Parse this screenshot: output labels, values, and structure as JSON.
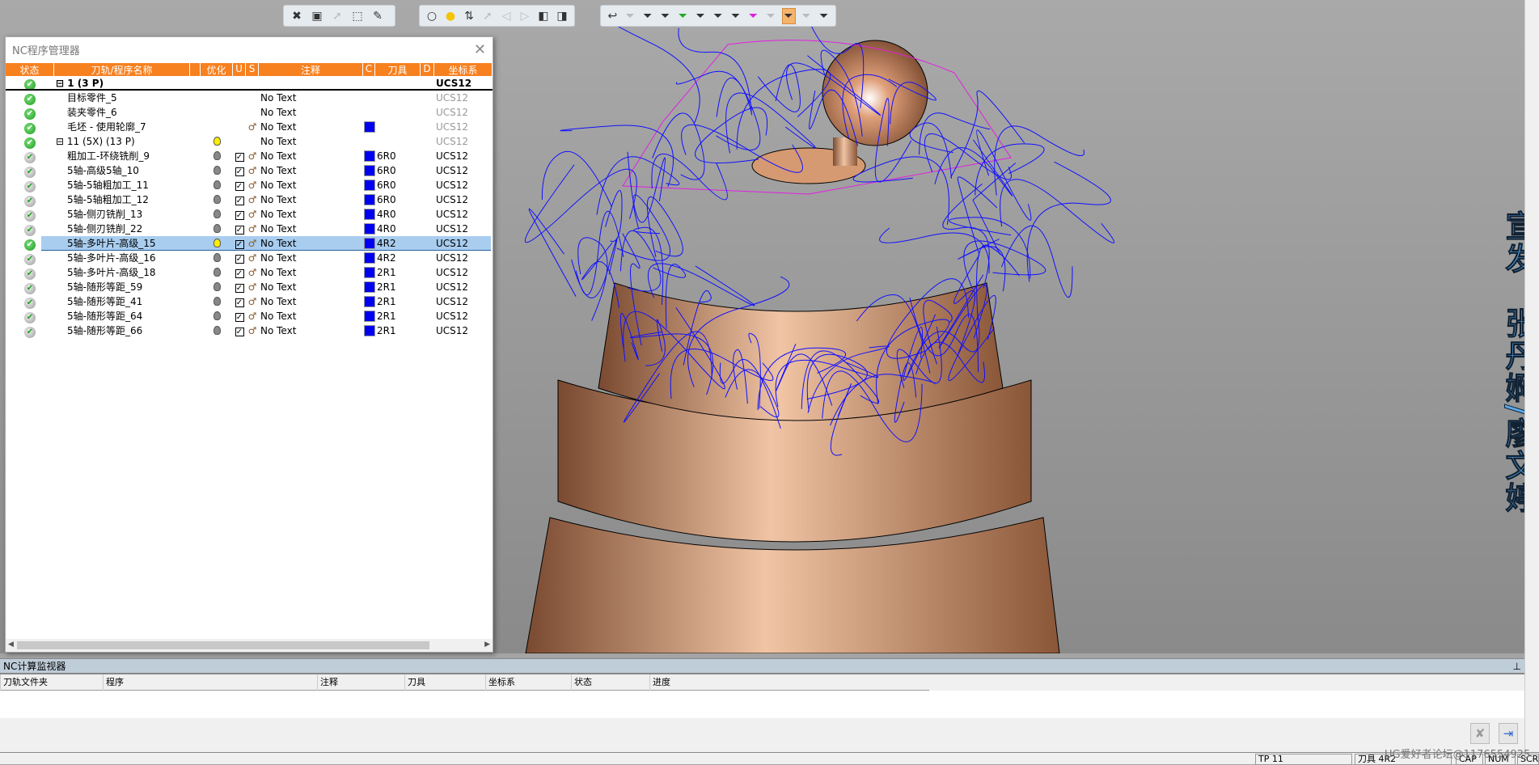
{
  "toolbars": [
    {
      "icons": [
        "deselect-icon",
        "wireframe-select-icon",
        "select-filter-icon",
        "box-select-icon",
        "clear-filter-icon"
      ]
    },
    {
      "icons": [
        "bulb-off-icon",
        "bulb-on-icon",
        "toggle-display-icon",
        "pointer-bulb-icon",
        "arrow-left-icon",
        "arrow-right-icon",
        "cube-icon",
        "cube-cursor-icon"
      ]
    },
    {
      "icons": [
        "undo-icon",
        "filter-icon",
        "axis-filter-icon",
        "shape-filter-icon",
        "check-filter-icon",
        "curve-filter-icon",
        "curve-filter-2-icon",
        "plane-filter-icon",
        "pink-plane-filter-icon",
        "dim-filter-icon",
        "path-filter-icon",
        "solid-filter-icon",
        "point-filter-icon"
      ]
    }
  ],
  "watermark_vertical": "宣发：张丹婀/廖文婷",
  "panel": {
    "title": "NC程序管理器",
    "columns": [
      "状态",
      "刀轨/程序名称",
      "",
      "优化",
      "U",
      "S",
      "注释",
      "C",
      "刀具",
      "D",
      "坐标系"
    ],
    "rows": [
      {
        "name": "1 (3 P)",
        "group": true,
        "comment": "",
        "tool": "",
        "ucs": "UCS12"
      },
      {
        "name": "目标零件_5",
        "comment": "No Text",
        "tool": "",
        "ucs": "UCS12"
      },
      {
        "name": "装夹零件_6",
        "comment": "No Text",
        "tool": "",
        "ucs": "UCS12"
      },
      {
        "name": "毛坯 - 使用轮廓_7",
        "comment": "No Text",
        "tool": "",
        "ucs": "UCS12"
      },
      {
        "name": "11 (5X) (13 P)",
        "group": true,
        "comment": "No Text",
        "tool": "",
        "ucs": "UCS12"
      },
      {
        "name": "粗加工-环绕铣削_9",
        "comment": "No Text",
        "tool": "6R0",
        "ucs": "UCS12"
      },
      {
        "name": "5轴-高级5轴_10",
        "comment": "No Text",
        "tool": "6R0",
        "ucs": "UCS12"
      },
      {
        "name": "5轴-5轴粗加工_11",
        "comment": "No Text",
        "tool": "6R0",
        "ucs": "UCS12"
      },
      {
        "name": "5轴-5轴粗加工_12",
        "comment": "No Text",
        "tool": "6R0",
        "ucs": "UCS12"
      },
      {
        "name": "5轴-侧刃铣削_13",
        "comment": "No Text",
        "tool": "4R0",
        "ucs": "UCS12"
      },
      {
        "name": "5轴-侧刃铣削_22",
        "comment": "No Text",
        "tool": "4R0",
        "ucs": "UCS12"
      },
      {
        "name": "5轴-多叶片-高级_15",
        "comment": "No Text",
        "tool": "4R2",
        "ucs": "UCS12",
        "selected": true
      },
      {
        "name": "5轴-多叶片-高级_16",
        "comment": "No Text",
        "tool": "4R2",
        "ucs": "UCS12"
      },
      {
        "name": "5轴-多叶片-高级_18",
        "comment": "No Text",
        "tool": "2R1",
        "ucs": "UCS12"
      },
      {
        "name": "5轴-随形等距_59",
        "comment": "No Text",
        "tool": "2R1",
        "ucs": "UCS12"
      },
      {
        "name": "5轴-随形等距_41",
        "comment": "No Text",
        "tool": "2R1",
        "ucs": "UCS12"
      },
      {
        "name": "5轴-随形等距_64",
        "comment": "No Text",
        "tool": "2R1",
        "ucs": "UCS12"
      },
      {
        "name": "5轴-随形等距_66",
        "comment": "No Text",
        "tool": "2R1",
        "ucs": "UCS12"
      }
    ]
  },
  "monitor": {
    "title": "NC计算监视器",
    "pin": "ꟷ",
    "columns": [
      "刀轨文件夹",
      "程序",
      "注释",
      "刀具",
      "坐标系",
      "状态",
      "进度"
    ]
  },
  "status": {
    "tp": "TP 11",
    "tool": "刀具 4R2",
    "cap": "CAP",
    "num": "NUM",
    "scr": "SCR"
  },
  "watermark_bottom": "UG爱好者论坛@1176554925",
  "colors": {
    "header": "#f7801f",
    "selection": "#a8cdef",
    "tool_swatch": "#0000f0",
    "toolpath": "#1010ff",
    "part": "#b87a55"
  }
}
